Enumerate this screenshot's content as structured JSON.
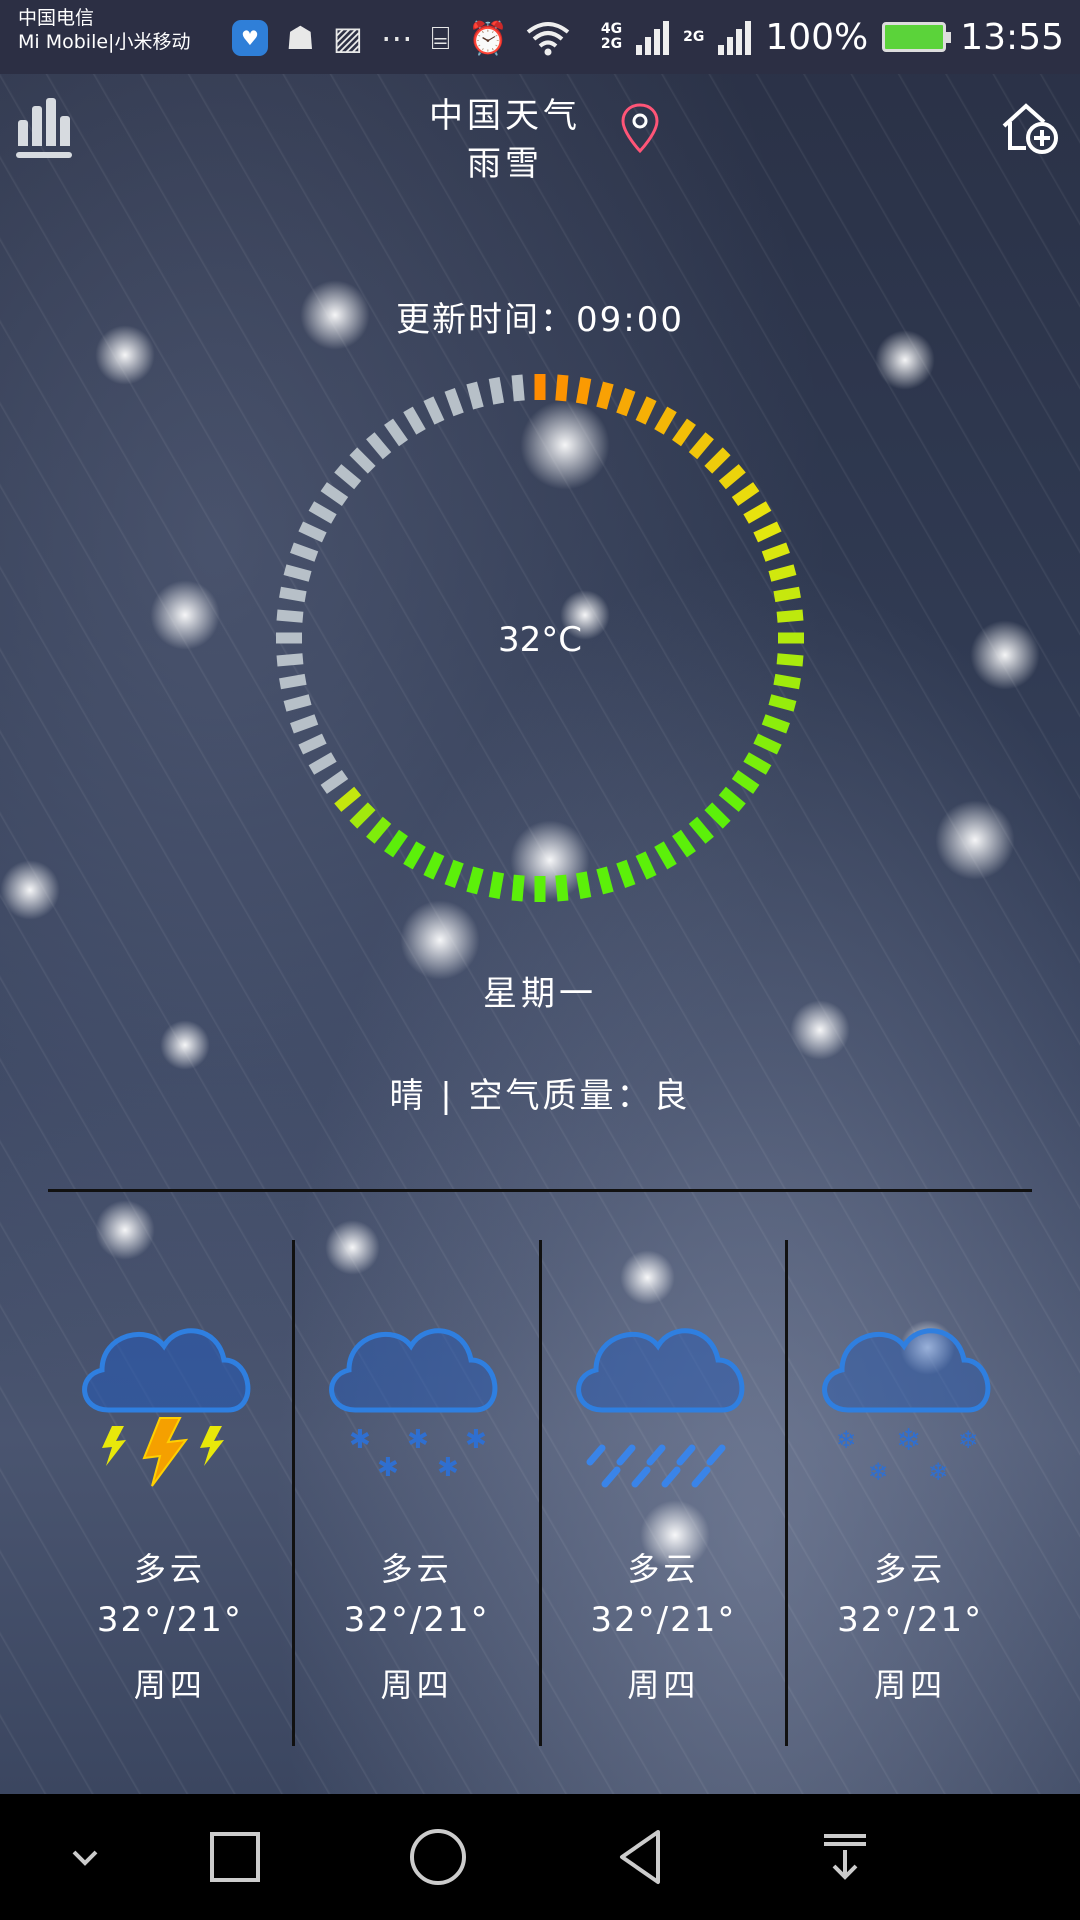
{
  "status_bar": {
    "carrier_line1": "中国电信",
    "carrier_line2": "Mi Mobile|小米移动",
    "network_4g": "4G",
    "network_2g_a": "2G",
    "network_2g_b": "2G",
    "battery": "100%",
    "time": "13:55",
    "icons": [
      "health-app-icon",
      "android-icon",
      "image-icon",
      "more-icon",
      "vibrate-icon",
      "alarm-icon",
      "wifi-icon",
      "signal-icon",
      "battery-icon"
    ],
    "battery_color": "#5bd33a"
  },
  "header": {
    "city": "中国天气",
    "weather": "雨雪"
  },
  "current": {
    "update_time": "更新时间：09:00",
    "temperature": "32°C",
    "weekday": "星期一",
    "summary": "晴 | 空气质量：良"
  },
  "ring_colors": {
    "gray": "#b7c0c8",
    "orange": "#ff8c00",
    "yellow": "#e7e60f",
    "green": "#5cf00a"
  },
  "forecast": [
    {
      "icon": "thunderstorm-icon",
      "condition": "多云",
      "range": "32°/21°",
      "day": "周四"
    },
    {
      "icon": "snow-icon",
      "condition": "多云",
      "range": "32°/21°",
      "day": "周四"
    },
    {
      "icon": "rain-icon",
      "condition": "多云",
      "range": "32°/21°",
      "day": "周四"
    },
    {
      "icon": "snowflake-icon",
      "condition": "多云",
      "range": "32°/21°",
      "day": "周四"
    }
  ],
  "nav_bar": [
    "collapse-icon",
    "recents-icon",
    "home-icon",
    "back-icon",
    "notification-pull-icon"
  ]
}
